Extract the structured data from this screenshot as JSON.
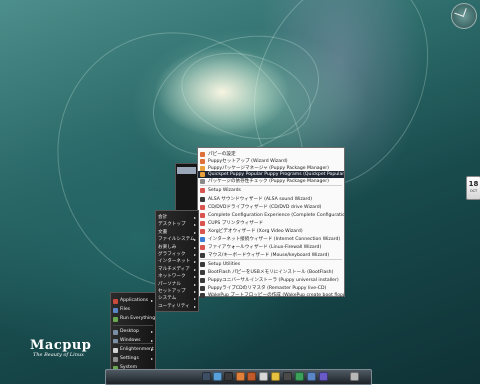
{
  "branding": {
    "title": "Macpup",
    "tagline": "The Beauty of Linux"
  },
  "date_widget": {
    "day": "18",
    "month": "OCT"
  },
  "main_menu": {
    "items": [
      {
        "label": "Applications",
        "icon_color": "#c94b3b",
        "has_submenu": true
      },
      {
        "label": "Files",
        "icon_color": "#5b86c6",
        "has_submenu": false
      },
      {
        "label": "Run Everything",
        "icon_color": "#6aa84f",
        "has_submenu": false
      },
      {
        "label": "Desktop",
        "icon_color": "#7a8fa6",
        "has_submenu": true
      },
      {
        "label": "Windows",
        "icon_color": "#7a8fa6",
        "has_submenu": true
      },
      {
        "label": "Enlightenment",
        "icon_color": "#d4d4d4",
        "has_submenu": true
      },
      {
        "label": "Settings",
        "icon_color": "#8f8f8f",
        "has_submenu": true
      },
      {
        "label": "System",
        "icon_color": "#6aa84f",
        "has_submenu": false
      }
    ]
  },
  "category_menu": {
    "items": [
      {
        "label": "会計"
      },
      {
        "label": "デスクトップ"
      },
      {
        "label": "文書"
      },
      {
        "label": "ファイルシステム"
      },
      {
        "label": "お楽しみ"
      },
      {
        "label": "グラフィック"
      },
      {
        "label": "インターネット"
      },
      {
        "label": "マルチメディア"
      },
      {
        "label": "ネットワーク"
      },
      {
        "label": "パーソナル"
      },
      {
        "label": "セットアップ"
      },
      {
        "label": "システム"
      },
      {
        "label": "ユーティリティ"
      }
    ]
  },
  "wizard_menu": {
    "items": [
      {
        "label": "パピーの設定",
        "icon_color": "#e0703a"
      },
      {
        "label": "Puppyセットアップ (Wizard Wizard)",
        "icon_color": "#e0703a"
      },
      {
        "label": "Puppyパッケージマネージャ (Puppy Package Manager)",
        "icon_color": "#e8a03a"
      },
      {
        "label": "Quickpet Puppy Popular Puppy Programs (Quickpet Popular Programs)",
        "icon_color": "#e8a03a",
        "selected": true
      },
      {
        "label": "パッケージの依存性チェック (Puppy Package Manager)",
        "icon_color": "#8a8a8a"
      },
      {
        "label": "Setup Wizards",
        "icon_color": "#d9534f"
      },
      {
        "label": "ALSA サウンドウィザード (ALSA sound Wizard)",
        "icon_color": "#3a3a3a"
      },
      {
        "label": "CD/DVDドライブウィザード (CD/DVD drive Wizard)",
        "icon_color": "#d9534f"
      },
      {
        "label": "Complete Configuration Experience (Complete Configuration Experience)",
        "icon_color": "#d9534f"
      },
      {
        "label": "CUPS プリンタウィザード",
        "icon_color": "#d9534f"
      },
      {
        "label": "Xorgビデオウィザード (Xorg Video Wizard)",
        "icon_color": "#d9534f"
      },
      {
        "label": "インターネット接続ウィザード (Internet Connection Wizard)",
        "icon_color": "#3b7bd4"
      },
      {
        "label": "ファイアウォールウィザード (Linux-Firewall Wizard)",
        "icon_color": "#d9534f"
      },
      {
        "label": "マウス/キーボードウィザード (Mouse/keyboard Wizard)",
        "icon_color": "#3a3a3a"
      },
      {
        "label": "Setup Utilities",
        "icon_color": "#3a3a3a"
      },
      {
        "label": "BootFlash パピーをUSBメモリにインストール (BootFlash)",
        "icon_color": "#3a3a3a"
      },
      {
        "label": "Puppyユニバーサルインストーラ (Puppy universal installer)",
        "icon_color": "#3a3a3a"
      },
      {
        "label": "PuppyライブCDのリマスタ (Remaster Puppy live-CD)",
        "icon_color": "#3a3a3a"
      },
      {
        "label": "WakePup ブートフロッピーの作成 (WakePup create boot floppy)",
        "icon_color": "#3a3a3a"
      }
    ]
  },
  "taskbar": {
    "icons": [
      {
        "name": "monitor-icon",
        "color": "#3f4f63"
      },
      {
        "name": "home-icon",
        "color": "#5aa0d8"
      },
      {
        "name": "terminal-icon",
        "color": "#3a3a3a"
      },
      {
        "name": "browser-icon",
        "color": "#e0803a"
      },
      {
        "name": "package-icon",
        "color": "#c05a2a"
      },
      {
        "name": "audio-icon",
        "color": "#d8d8d8"
      },
      {
        "name": "chat-icon",
        "color": "#e8c040"
      },
      {
        "name": "media-icon",
        "color": "#4a4a4a"
      },
      {
        "name": "gear-icon",
        "color": "#3aa05a"
      },
      {
        "name": "search-icon",
        "color": "#5a86c8"
      },
      {
        "name": "help-icon",
        "color": "#6a5ac8"
      },
      {
        "name": "trash-icon",
        "color": "#b8b8b8"
      }
    ]
  }
}
